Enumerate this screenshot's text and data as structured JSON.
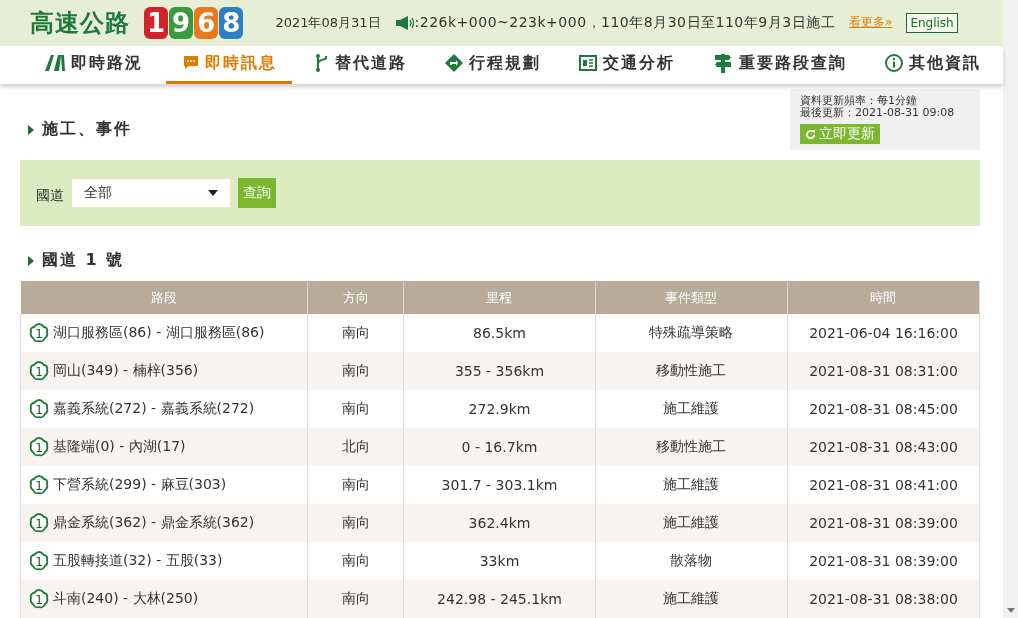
{
  "header": {
    "logo_text": "高速公路",
    "logo_digits": [
      "1",
      "9",
      "6",
      "8"
    ],
    "date": "2021年08月31日",
    "announcement": ":226k+000~223k+000，110年8月30日至110年9月3日施工",
    "more_link": "看更多»",
    "language_button": "English"
  },
  "nav": [
    {
      "label": "即時路況",
      "selected": false
    },
    {
      "label": "即時訊息",
      "selected": true
    },
    {
      "label": "替代道路",
      "selected": false
    },
    {
      "label": "行程規劃",
      "selected": false
    },
    {
      "label": "交通分析",
      "selected": false
    },
    {
      "label": "重要路段查詢",
      "selected": false
    },
    {
      "label": "其他資訊",
      "selected": false
    }
  ],
  "page_title": "施工、事件",
  "update_box": {
    "frequency": "資料更新頻率：每1分鐘",
    "last_updated": "最後更新：2021-08-31 09:08",
    "refresh_button": "立即更新"
  },
  "filter": {
    "label": "國道",
    "select_value": "全部",
    "query_button": "查詢"
  },
  "section_title": "國道 1 號",
  "table": {
    "columns": [
      "路段",
      "方向",
      "里程",
      "事件類型",
      "時間"
    ],
    "rows": [
      {
        "shield": "1",
        "segment": "湖口服務區(86) - 湖口服務區(86)",
        "direction": "南向",
        "mileage": "86.5km",
        "type": "特殊疏導策略",
        "time": "2021-06-04 16:16:00"
      },
      {
        "shield": "1",
        "segment": "岡山(349) - 楠梓(356)",
        "direction": "南向",
        "mileage": "355 - 356km",
        "type": "移動性施工",
        "time": "2021-08-31 08:31:00"
      },
      {
        "shield": "1",
        "segment": "嘉義系統(272) - 嘉義系統(272)",
        "direction": "南向",
        "mileage": "272.9km",
        "type": "施工維護",
        "time": "2021-08-31 08:45:00"
      },
      {
        "shield": "1",
        "segment": "基隆端(0) - 內湖(17)",
        "direction": "北向",
        "mileage": "0 - 16.7km",
        "type": "移動性施工",
        "time": "2021-08-31 08:43:00"
      },
      {
        "shield": "1",
        "segment": "下營系統(299) - 麻豆(303)",
        "direction": "南向",
        "mileage": "301.7 - 303.1km",
        "type": "施工維護",
        "time": "2021-08-31 08:41:00"
      },
      {
        "shield": "1",
        "segment": "鼎金系統(362) - 鼎金系統(362)",
        "direction": "南向",
        "mileage": "362.4km",
        "type": "施工維護",
        "time": "2021-08-31 08:39:00"
      },
      {
        "shield": "1",
        "segment": "五股轉接道(32) - 五股(33)",
        "direction": "南向",
        "mileage": "33km",
        "type": "散落物",
        "time": "2021-08-31 08:39:00"
      },
      {
        "shield": "1",
        "segment": "斗南(240) - 大林(250)",
        "direction": "南向",
        "mileage": "242.98 - 245.1km",
        "type": "施工維護",
        "time": "2021-08-31 08:38:00"
      }
    ]
  }
}
